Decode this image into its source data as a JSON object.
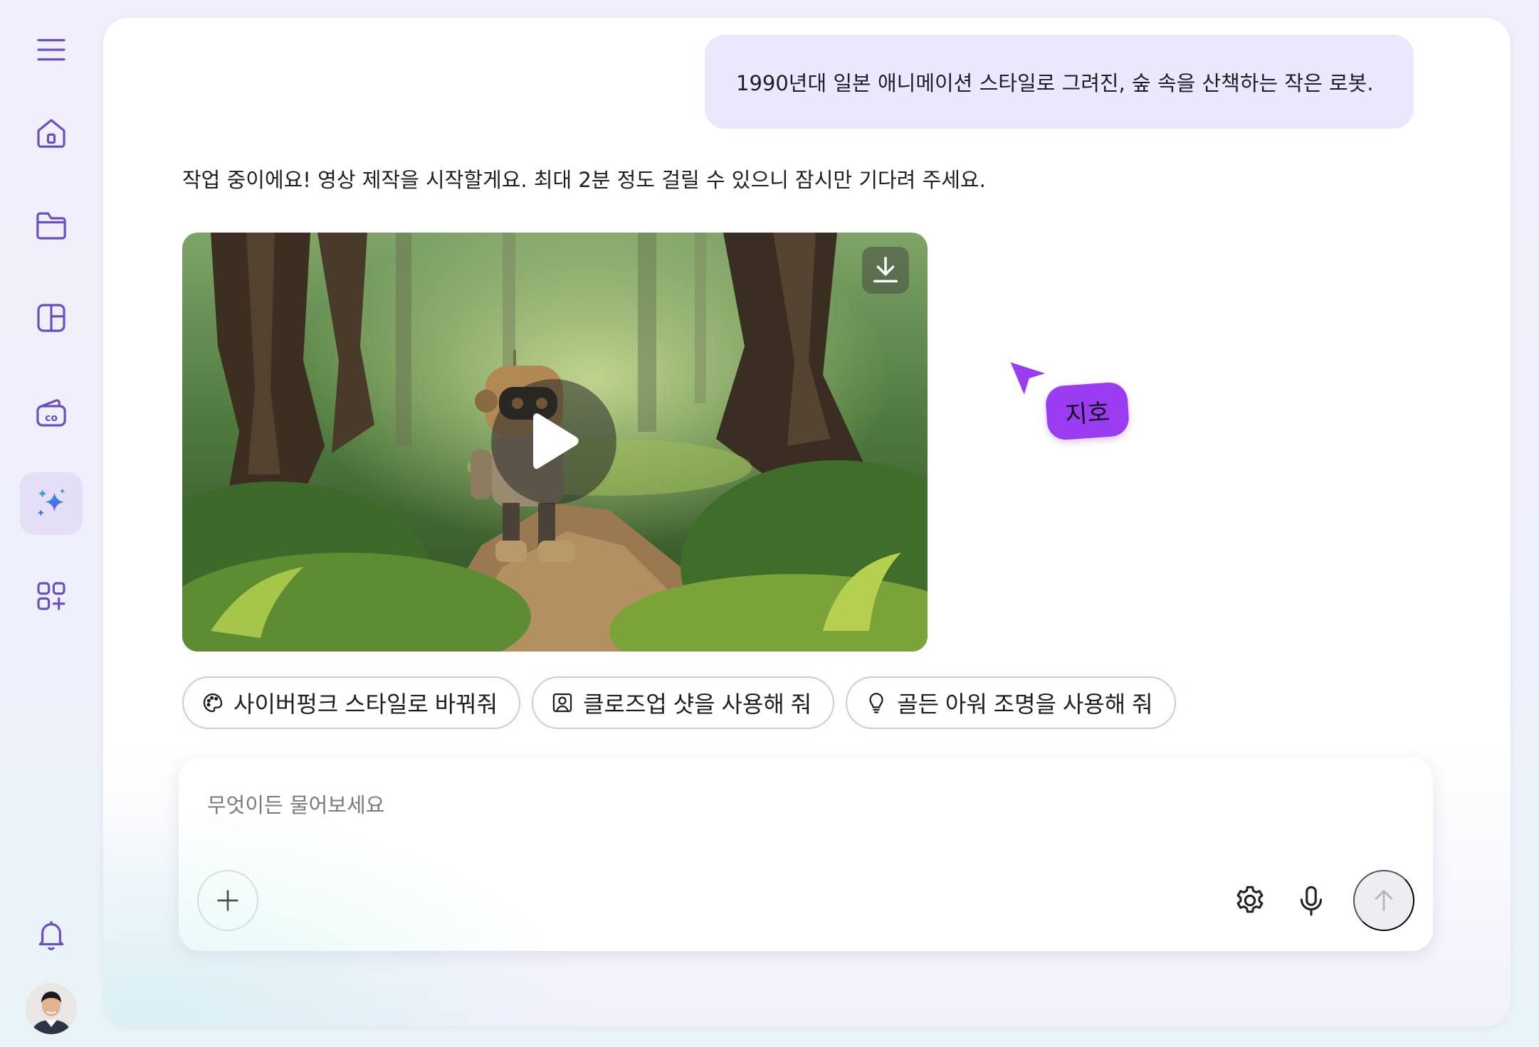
{
  "sidebar": {
    "items": [
      {
        "name": "menu",
        "icon": "menu-icon"
      },
      {
        "name": "home",
        "icon": "home-icon"
      },
      {
        "name": "folder",
        "icon": "folder-icon"
      },
      {
        "name": "layout",
        "icon": "layout-icon"
      },
      {
        "name": "co",
        "icon": "co-wallet-icon"
      },
      {
        "name": "ai",
        "icon": "sparkle-icon",
        "active": true
      },
      {
        "name": "apps",
        "icon": "apps-add-icon"
      }
    ],
    "bottom": [
      {
        "name": "notifications",
        "icon": "bell-icon"
      },
      {
        "name": "profile",
        "icon": "avatar"
      }
    ]
  },
  "conversation": {
    "user_message": "1990년대 일본 애니메이션 스타일로 그려진, 숲 속을 산책하는 작은 로봇.",
    "assistant_message": "작업 중이에요! 영상 제작을 시작할게요. 최대 2분 정도 걸릴 수 있으니 잠시만 기다려 주세요.",
    "video": {
      "play_icon": "play-icon",
      "download_icon": "download-icon"
    }
  },
  "cursor": {
    "label": "지호",
    "color": "#9b3cf2"
  },
  "suggestions": [
    {
      "label": "사이버펑크 스타일로 바꿔줘",
      "icon": "palette-icon"
    },
    {
      "label": "클로즈업 샷을 사용해 줘",
      "icon": "portrait-icon"
    },
    {
      "label": "골든 아워 조명을 사용해 줘",
      "icon": "lightbulb-icon"
    }
  ],
  "composer": {
    "placeholder": "무엇이든 물어보세요",
    "value": ""
  },
  "colors": {
    "accent": "#6a4fc4",
    "bubble": "#ece7fc",
    "chip_border": "#d6c2f2"
  }
}
